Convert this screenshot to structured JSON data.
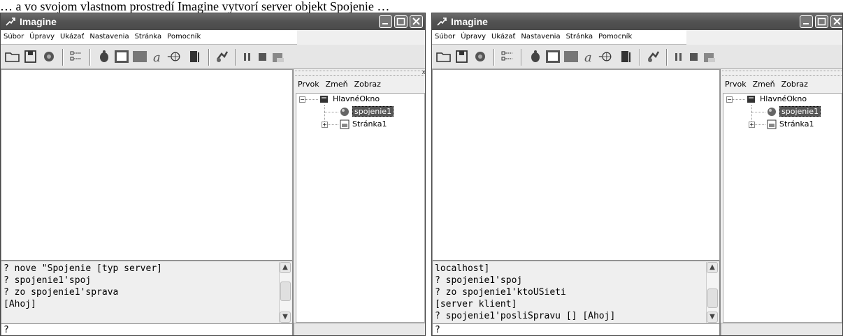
{
  "caption": "… a vo svojom vlastnom prostredí Imagine vytvorí server objekt Spojenie …",
  "window_left": {
    "title": "Imagine",
    "menu": [
      "Súbor",
      "Úpravy",
      "Ukázať",
      "Nastavenia",
      "Stránka",
      "Pomocník"
    ],
    "panel_menu": [
      "Prvok",
      "Zmeň",
      "Zobraz"
    ],
    "tree": {
      "root": "HlavnéOkno",
      "child1": "spojenie1",
      "child2": "Stránka1"
    },
    "console_lines": "? nove \"Spojenie [typ server]\n? spojenie1'spoj\n? zo spojenie1'sprava\n[Ahoj]",
    "input": "?"
  },
  "window_right": {
    "title": "Imagine",
    "menu": [
      "Súbor",
      "Úpravy",
      "Ukázať",
      "Nastavenia",
      "Stránka",
      "Pomocník"
    ],
    "panel_menu": [
      "Prvok",
      "Zmeň",
      "Zobraz"
    ],
    "tree": {
      "root": "HlavnéOkno",
      "child1": "spojenie1",
      "child2": "Stránka1"
    },
    "console_lines": "localhost]\n? spojenie1'spoj\n? zo spojenie1'ktoUSieti\n[server klient]\n? spojenie1'posliSpravu [] [Ahoj]",
    "input": "?"
  },
  "colors": {
    "titlebar": "#555555",
    "selection": "#555555",
    "canvas": "#ffffff"
  },
  "toolbar_icons": [
    "open-folder-icon",
    "save-icon",
    "turtle-icon",
    "tree-icon",
    "turtle-small-icon",
    "frame-button-icon",
    "rectangle-icon",
    "text-icon",
    "globe-icon",
    "door-icon",
    "run-icon",
    "pause-icon",
    "stop-icon",
    "reset-icon"
  ]
}
